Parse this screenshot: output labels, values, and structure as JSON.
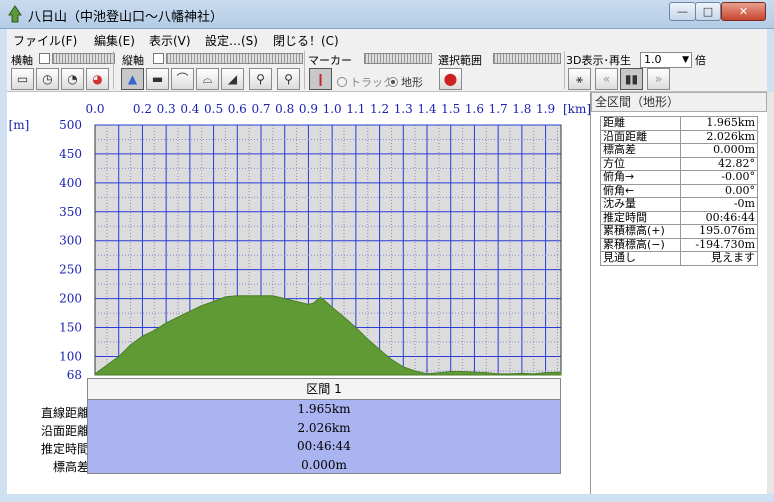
{
  "window": {
    "title": "八日山（中池登山口～八幡神社）",
    "min": "—",
    "max": "□",
    "close": "✕"
  },
  "menu": [
    "ファイル(F)",
    "編集(E)",
    "表示(V)",
    "設定…(S)",
    "閉じる！(C)"
  ],
  "toolbar": {
    "horizontal_axis": "横軸",
    "vertical_axis": "縦軸",
    "marker": "マーカー",
    "selection_range": "選択範囲",
    "view3d": "3D表示･再生",
    "speed_value": "1.0",
    "speed_unit": "倍",
    "radio_track": "トラック",
    "radio_terrain": "地形",
    "buttons": [
      "ruler-icon",
      "clock-icon",
      "clock-123-icon",
      "pie-icon",
      "mountain-icon",
      "flat-bar-icon",
      "arc-icon",
      "arc-dots-icon",
      "slope-icon",
      "walker-icon",
      "walker2-icon",
      "marker-icon",
      "select-icon",
      "compass-icon",
      "rewind-icon",
      "pause-icon",
      "forward-icon"
    ]
  },
  "chart_data": {
    "type": "area",
    "xlabel": "[km]",
    "ylabel": "[m]",
    "x_ticks": [
      "0.0",
      "0.2",
      "0.3",
      "0.4",
      "0.5",
      "0.6",
      "0.7",
      "0.8",
      "0.9",
      "1.0",
      "1.1",
      "1.2",
      "1.3",
      "1.4",
      "1.5",
      "1.6",
      "1.7",
      "1.8",
      "1.9"
    ],
    "y_ticks": [
      "500",
      "450",
      "400",
      "350",
      "300",
      "250",
      "200",
      "150",
      "100",
      "68"
    ],
    "xlim": [
      0,
      1.965
    ],
    "ylim": [
      68,
      500
    ],
    "fill_color": "#5f9a35",
    "x": [
      0.0,
      0.05,
      0.1,
      0.15,
      0.2,
      0.25,
      0.3,
      0.35,
      0.4,
      0.45,
      0.5,
      0.55,
      0.6,
      0.65,
      0.7,
      0.75,
      0.8,
      0.85,
      0.9,
      0.92,
      0.95,
      0.97,
      1.0,
      1.05,
      1.1,
      1.15,
      1.2,
      1.25,
      1.3,
      1.35,
      1.4,
      1.45,
      1.5,
      1.55,
      1.6,
      1.65,
      1.7,
      1.75,
      1.8,
      1.85,
      1.9,
      1.965
    ],
    "y": [
      70,
      85,
      100,
      120,
      135,
      145,
      158,
      168,
      178,
      188,
      195,
      203,
      205,
      205,
      205,
      205,
      200,
      195,
      190,
      192,
      202,
      196,
      185,
      168,
      150,
      130,
      112,
      95,
      82,
      75,
      70,
      72,
      74,
      74,
      73,
      72,
      70,
      70,
      71,
      70,
      72,
      73
    ]
  },
  "section_table": {
    "header": "区間 1",
    "rows": [
      {
        "label": "直線距離",
        "value": "1.965km"
      },
      {
        "label": "沿面距離",
        "value": "2.026km"
      },
      {
        "label": "推定時間",
        "value": "00:46:44"
      },
      {
        "label": "標高差",
        "value": "0.000m"
      }
    ]
  },
  "side_panel": {
    "header": "全区間（地形）",
    "rows": [
      {
        "label": "距離",
        "value": "1.965km"
      },
      {
        "label": "沿面距離",
        "value": "2.026km"
      },
      {
        "label": "標高差",
        "value": "0.000m"
      },
      {
        "label": "方位",
        "value": "42.82°"
      },
      {
        "label": "俯角→",
        "value": "-0.00°"
      },
      {
        "label": "俯角←",
        "value": "0.00°"
      },
      {
        "label": "沈み量",
        "value": "-0m"
      },
      {
        "label": "推定時間",
        "value": "00:46:44"
      },
      {
        "label": "累積標高(+)",
        "value": "195.076m"
      },
      {
        "label": "累積標高(−)",
        "value": "-194.730m"
      },
      {
        "label": "見通し",
        "value": "見えます"
      }
    ]
  }
}
